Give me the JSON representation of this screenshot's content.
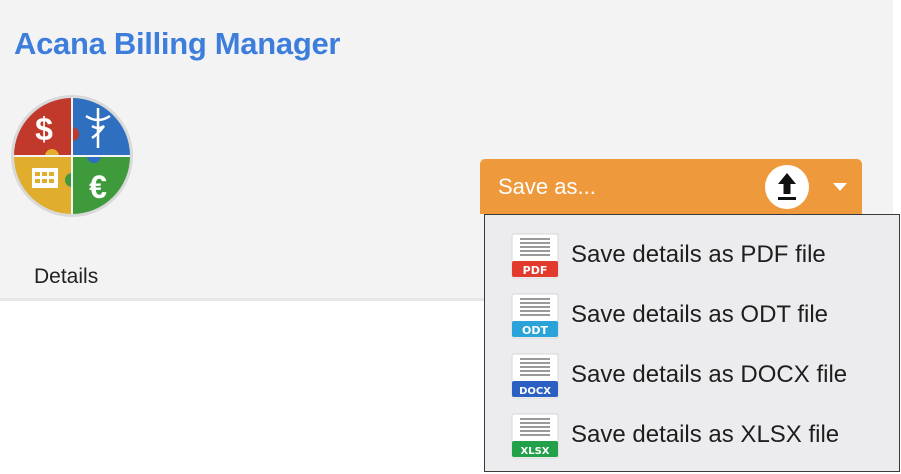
{
  "app": {
    "title": "Acana Billing Manager"
  },
  "logo": {
    "icon": "billing-puzzle-logo",
    "quadrant_colors": [
      "#c0392b",
      "#2f6fc0",
      "#e1ad2c",
      "#3f9a3c"
    ]
  },
  "details": {
    "label": "Details"
  },
  "save_menu": {
    "button_label": "Save as...",
    "button_color": "#ee9a3c",
    "upload_icon": "upload-icon",
    "chevron_icon": "chevron-down-icon",
    "items": [
      {
        "label": "Save details as PDF file",
        "badge": "PDF",
        "badge_color": "#e23b2e"
      },
      {
        "label": "Save details as ODT file",
        "badge": "ODT",
        "badge_color": "#2aa3d8"
      },
      {
        "label": "Save details as DOCX file",
        "badge": "DOCX",
        "badge_color": "#2b5fc2"
      },
      {
        "label": "Save details as XLSX file",
        "badge": "XLSX",
        "badge_color": "#22a04a"
      }
    ]
  }
}
